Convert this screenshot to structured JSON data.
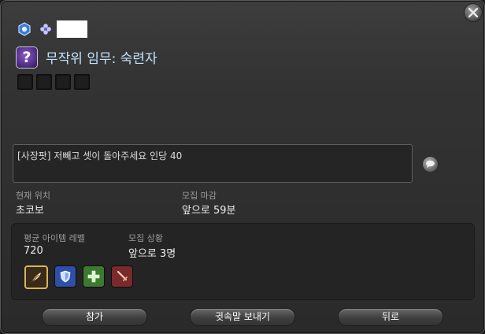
{
  "window": {
    "close_icon": "close-x-icon",
    "job_icon": "job-class-icon",
    "secondary_icon": "flower-icon",
    "player_name": ""
  },
  "duty": {
    "icon": "random-duty-question-icon",
    "title": "무작위 임무: 숙련자",
    "slots": 4
  },
  "comment": {
    "text": "[사장팟] 저빼고 셋이 돌아주세요 인당 40",
    "chat_icon": "speech-bubble-icon"
  },
  "info": {
    "location_label": "현재 위치",
    "location_value": "초코보",
    "deadline_label": "모집 마감",
    "deadline_value": "앞으로 59분"
  },
  "party": {
    "avg_ilvl_label": "평균 아이템 레벨",
    "avg_ilvl_value": "720",
    "status_label": "모집 상황",
    "status_value": "앞으로 3명",
    "roles": [
      "leader-feather-icon",
      "tank-shield-icon",
      "healer-cross-icon",
      "dps-sword-icon"
    ]
  },
  "buttons": {
    "join": "참가",
    "whisper": "귓속말 보내기",
    "back": "뒤로"
  },
  "colors": {
    "title": "#bfe4ff",
    "tank": "#2f4fa8",
    "healer": "#3d7a2f",
    "dps": "#7a2a2a",
    "leader_border": "#d8b45a"
  }
}
